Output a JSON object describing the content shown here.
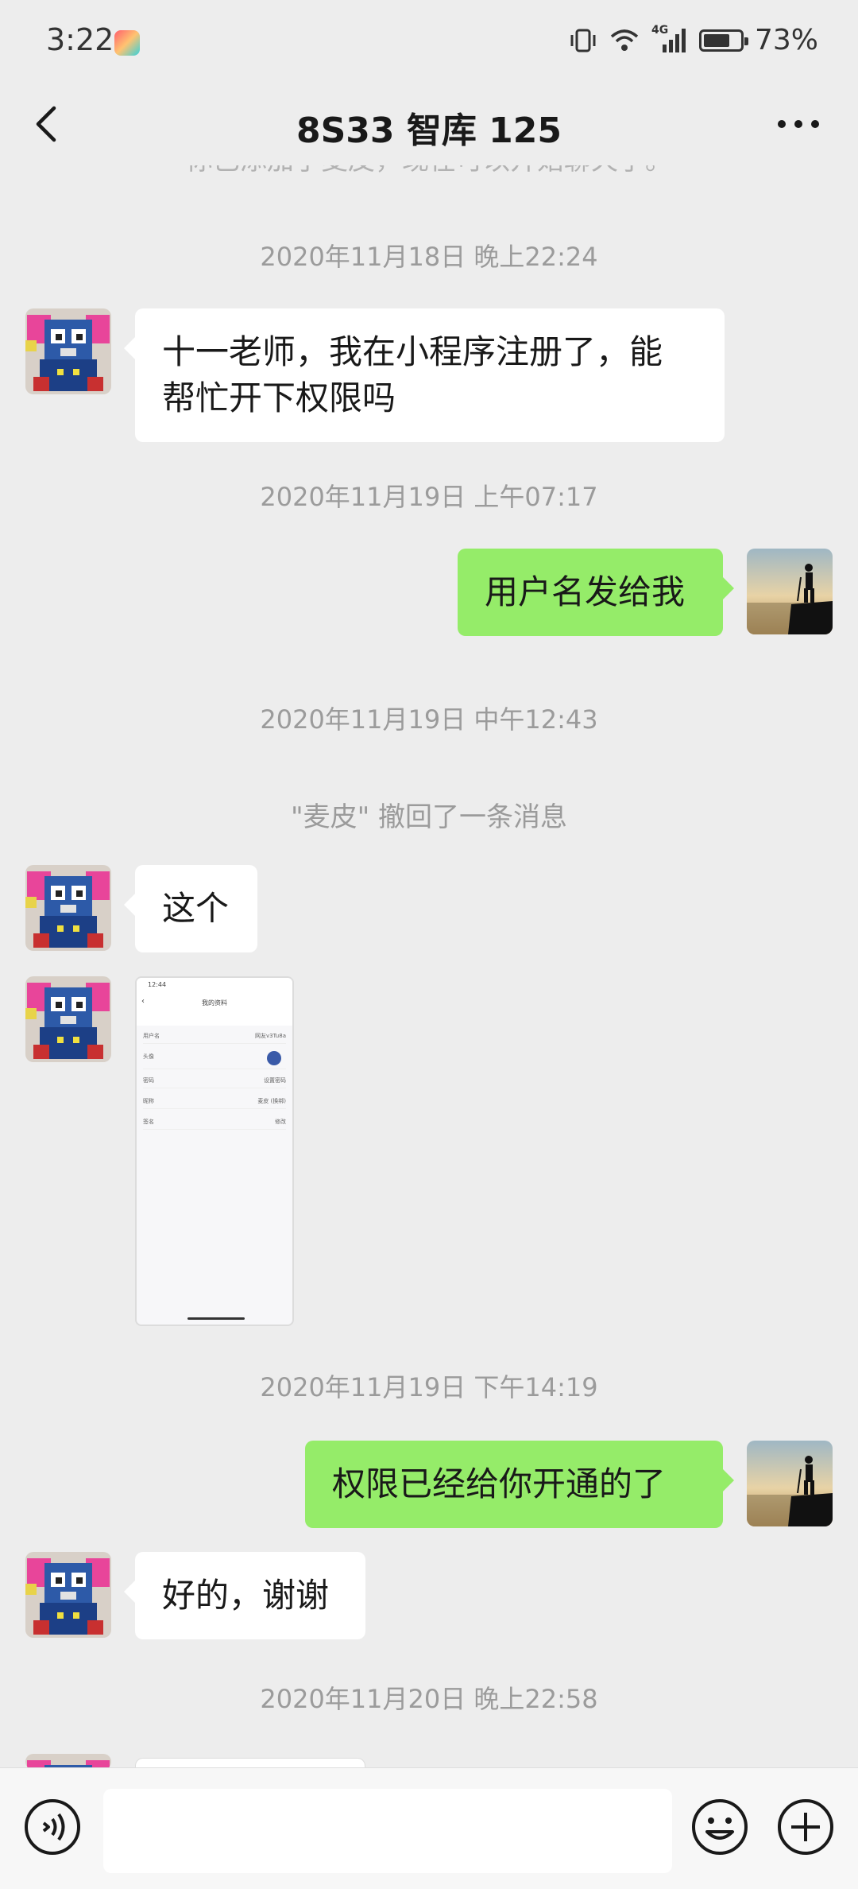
{
  "status_bar": {
    "time": "3:22",
    "network": "4G",
    "battery_percent": "73%",
    "battery_level": 0.73
  },
  "header": {
    "title": "8S33 智库 125"
  },
  "chat": {
    "cut_system_text": "你已添加了麦皮，现在可以开始聊天了。",
    "messages": [
      {
        "type": "timestamp",
        "text": "2020年11月18日 晚上22:24"
      },
      {
        "type": "text",
        "side": "left",
        "text_line1": "十一老师，我在小程序注册了，能",
        "text_line2": "帮忙开下权限吗"
      },
      {
        "type": "timestamp",
        "text": "2020年11月19日 上午07:17"
      },
      {
        "type": "text",
        "side": "right",
        "text": "用户名发给我"
      },
      {
        "type": "timestamp",
        "text": "2020年11月19日 中午12:43"
      },
      {
        "type": "system",
        "text": "\"麦皮\" 撤回了一条消息"
      },
      {
        "type": "text",
        "side": "left",
        "text": "这个"
      },
      {
        "type": "image",
        "side": "left",
        "screenshot": {
          "time": "12:44",
          "title": "我的资料",
          "rows": [
            {
              "label": "用户名",
              "value": "网友v3Tu8a"
            },
            {
              "label": "头像",
              "value": ""
            },
            {
              "label": "密码",
              "value": "设置密码"
            },
            {
              "label": "昵称",
              "value": "麦皮 (换绑)"
            },
            {
              "label": "签名",
              "value": "修改"
            }
          ]
        }
      },
      {
        "type": "timestamp",
        "text": "2020年11月19日 下午14:19"
      },
      {
        "type": "text",
        "side": "right",
        "text": "权限已经给你开通的了"
      },
      {
        "type": "text",
        "side": "left",
        "text": "好的，谢谢"
      },
      {
        "type": "timestamp",
        "text": "2020年11月20日 晚上22:58"
      }
    ]
  },
  "input_bar": {
    "placeholder": ""
  },
  "colors": {
    "background": "#ededed",
    "bubble_sent": "#95ec69",
    "bubble_received": "#ffffff",
    "timestamp": "#9b9b9b"
  }
}
